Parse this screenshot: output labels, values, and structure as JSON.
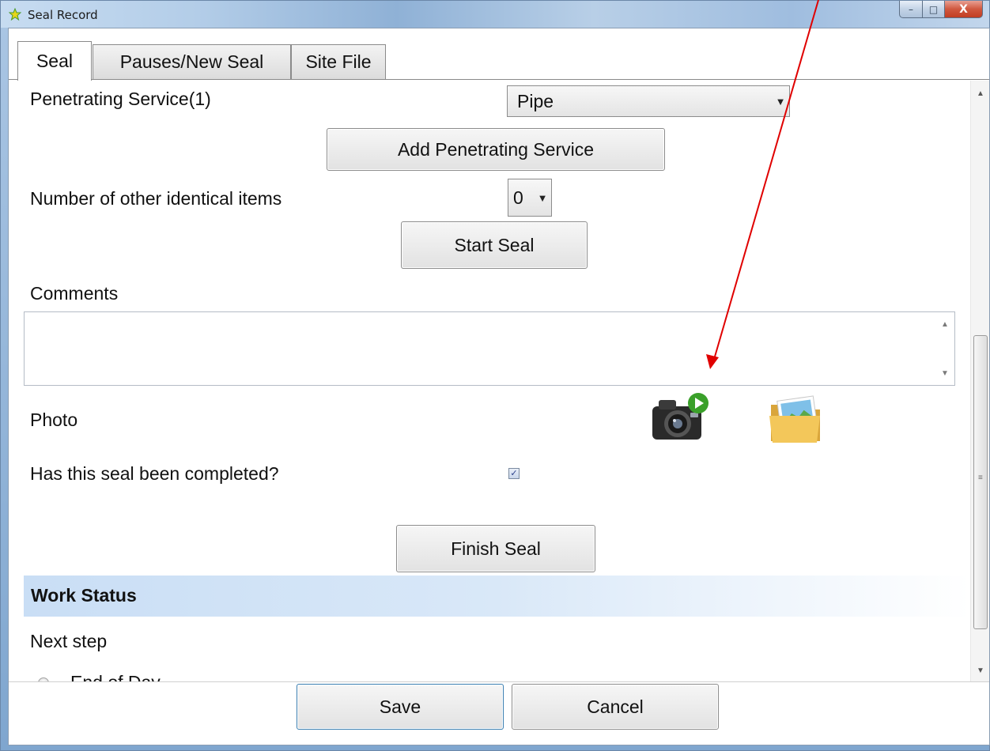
{
  "window": {
    "title": "Seal Record",
    "controls": {
      "minimize": "–",
      "maximize": "□",
      "close": "X"
    }
  },
  "tabs": [
    {
      "label": "Seal",
      "active": true
    },
    {
      "label": "Pauses/New Seal",
      "active": false
    },
    {
      "label": "Site File",
      "active": false
    }
  ],
  "form": {
    "penetrating_service_label": "Penetrating Service(1)",
    "penetrating_service_value": "Pipe",
    "add_service_button": "Add Penetrating Service",
    "identical_items_label": "Number of other identical items",
    "identical_items_value": "0",
    "start_seal_button": "Start Seal",
    "comments_label": "Comments",
    "comments_value": "",
    "photo_label": "Photo",
    "completed_label": "Has this seal been completed?",
    "completed_checked": true,
    "finish_seal_button": "Finish Seal"
  },
  "work_status": {
    "title": "Work Status",
    "next_step_label": "Next step",
    "options": [
      {
        "label": "End of Day",
        "selected": false
      }
    ]
  },
  "footer": {
    "save_button": "Save",
    "cancel_button": "Cancel"
  },
  "icons": {
    "title": "star-icon",
    "camera": "camera-icon",
    "folder": "image-folder-icon",
    "dropdown": "chevron-down-icon"
  },
  "colors": {
    "annotation_arrow": "#e00000",
    "section_band": "#c9def5",
    "close_button": "#c23d22"
  }
}
